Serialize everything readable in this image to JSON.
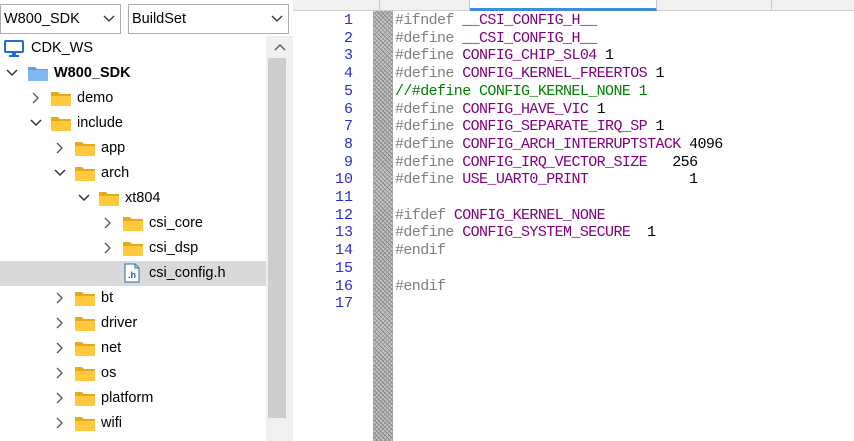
{
  "toolbar": {
    "project_combo": "W800_SDK",
    "build_combo": "BuildSet"
  },
  "tree": {
    "workspace": "CDK_WS",
    "project": "W800_SDK",
    "items": [
      {
        "label": "demo"
      },
      {
        "label": "include"
      },
      {
        "label": "app"
      },
      {
        "label": "arch"
      },
      {
        "label": "xt804"
      },
      {
        "label": "csi_core"
      },
      {
        "label": "csi_dsp"
      },
      {
        "label": "csi_config.h"
      },
      {
        "label": "bt"
      },
      {
        "label": "driver"
      },
      {
        "label": "net"
      },
      {
        "label": "os"
      },
      {
        "label": "platform"
      },
      {
        "label": "wifi"
      }
    ]
  },
  "colors": {
    "folder": "#ffc83d",
    "selection": "#d9d9d9",
    "line_numbers": "#2b2bd6",
    "preprocessor": "#7f7f7f",
    "macro": "#800080",
    "comment": "#008000",
    "active_tab": "#3c8ed8"
  },
  "icons": {
    "workspace": "monitor-icon",
    "project": "folder-blue-icon",
    "folder": "folder-icon",
    "file": "header-file-icon"
  },
  "editor": {
    "lines": [
      {
        "n": "1",
        "pp": "#ifndef ",
        "name": "__CSI_CONFIG_H__",
        "val": ""
      },
      {
        "n": "2",
        "pp": "#define ",
        "name": "__CSI_CONFIG_H__",
        "val": ""
      },
      {
        "n": "3",
        "pp": "#define ",
        "name": "CONFIG_CHIP_SL04",
        "val": " 1"
      },
      {
        "n": "4",
        "pp": "#define ",
        "name": "CONFIG_KERNEL_FREERTOS",
        "val": " 1"
      },
      {
        "n": "5",
        "comment": "//#define CONFIG_KERNEL_NONE 1"
      },
      {
        "n": "6",
        "pp": "#define ",
        "name": "CONFIG_HAVE_VIC",
        "val": " 1"
      },
      {
        "n": "7",
        "pp": "#define ",
        "name": "CONFIG_SEPARATE_IRQ_SP",
        "val": " 1"
      },
      {
        "n": "8",
        "pp": "#define ",
        "name": "CONFIG_ARCH_INTERRUPTSTACK",
        "val": " 4096"
      },
      {
        "n": "9",
        "pp": "#define ",
        "name": "CONFIG_IRQ_VECTOR_SIZE",
        "val": "   256"
      },
      {
        "n": "10",
        "pp": "#define ",
        "name": "USE_UART0_PRINT",
        "val": "            1"
      },
      {
        "n": "11"
      },
      {
        "n": "12",
        "pp": "#ifdef ",
        "name": "CONFIG_KERNEL_NONE",
        "val": ""
      },
      {
        "n": "13",
        "pp": "#define ",
        "name": "CONFIG_SYSTEM_SECURE",
        "val": "  1"
      },
      {
        "n": "14",
        "pp": "#endif",
        "name": "",
        "val": ""
      },
      {
        "n": "15"
      },
      {
        "n": "16",
        "pp": "#endif",
        "name": "",
        "val": ""
      },
      {
        "n": "17"
      }
    ]
  }
}
